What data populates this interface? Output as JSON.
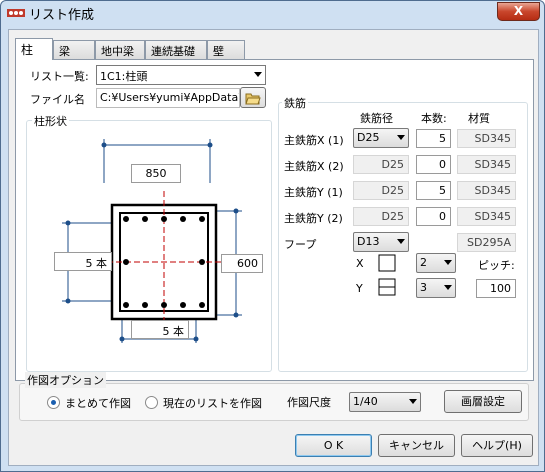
{
  "window": {
    "title": "リスト作成",
    "close_label": "X"
  },
  "tabs": [
    "柱",
    "梁",
    "地中梁",
    "連続基礎",
    "壁"
  ],
  "list": {
    "label": "リスト一覧:",
    "value": "1C1:柱頭"
  },
  "file": {
    "label": "ファイル名",
    "value": "C:¥Users¥yumi¥AppData¥F"
  },
  "shape": {
    "title": "柱形状",
    "width": "850",
    "height": "600",
    "count_y": "5",
    "count_x": "5",
    "unit": "本"
  },
  "rebar": {
    "title": "鉄筋",
    "headers": {
      "diameter": "鉄筋径",
      "count": "本数:",
      "material": "材質"
    },
    "rows": [
      {
        "label": "主鉄筋X (1)",
        "diameter": "D25",
        "count": "5",
        "material": "SD345"
      },
      {
        "label": "主鉄筋X (2)",
        "diameter": "D25",
        "count": "0",
        "material": "SD345"
      },
      {
        "label": "主鉄筋Y (1)",
        "diameter": "D25",
        "count": "5",
        "material": "SD345"
      },
      {
        "label": "主鉄筋Y (2)",
        "diameter": "D25",
        "count": "0",
        "material": "SD345"
      }
    ],
    "hoop": {
      "label": "フープ",
      "diameter": "D13",
      "material": "SD295A"
    },
    "x": {
      "label": "X",
      "value": "2"
    },
    "y": {
      "label": "Y",
      "value": "3"
    },
    "pitch": {
      "label": "ピッチ:",
      "value": "100"
    }
  },
  "options": {
    "title": "作図オプション",
    "radio1": "まとめて作図",
    "radio2": "現在のリストを作図",
    "scale_label": "作図尺度",
    "scale_value": "1/40",
    "layer_button": "画層設定"
  },
  "buttons": {
    "ok": "O K",
    "cancel": "キャンセル",
    "help": "ヘルプ(H)"
  },
  "colors": {
    "accent": "#c00000",
    "dim": "#1d4e89"
  }
}
